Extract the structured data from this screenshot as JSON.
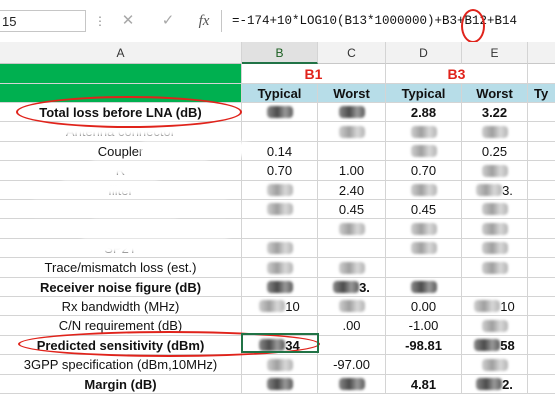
{
  "formula_bar": {
    "name_box": "15",
    "cancel_glyph": "✕",
    "enter_glyph": "✓",
    "fx_glyph": "fx",
    "formula": "=-174+10*LOG10(B13*1000000)+B3+B12+B14"
  },
  "columns": [
    "A",
    "B",
    "C",
    "D",
    "E"
  ],
  "groups": {
    "g1": "B1",
    "g2": "B3"
  },
  "subheaders": {
    "typical": "Typical",
    "worst": "Worst",
    "typical2": "Typical",
    "worst2": "Worst",
    "cut": "Ty"
  },
  "rows": [
    {
      "label": "Total loss before LNA (dB)",
      "bold": true,
      "b": "",
      "c": "",
      "d": "2.88",
      "e": "3.22"
    },
    {
      "label": "Antenna connector",
      "bold": false,
      "b": "",
      "c": "",
      "d": "",
      "e": ""
    },
    {
      "label": "Coupler",
      "bold": false,
      "b": "0.14",
      "c": "",
      "d": "",
      "e": "0.25"
    },
    {
      "label": "R",
      "bold": false,
      "b": "0.70",
      "c": "1.00",
      "d": "0.70",
      "e": ""
    },
    {
      "label": "filter",
      "bold": false,
      "b": "",
      "c": "2.40",
      "d": "",
      "e": "3."
    },
    {
      "label": "",
      "bold": false,
      "b": "",
      "c": "0.45",
      "d": "0.45",
      "e": ""
    },
    {
      "label": "",
      "bold": false,
      "b": "",
      "c": "",
      "d": "",
      "e": ""
    },
    {
      "label": "SP2T",
      "bold": false,
      "b": "",
      "c": "",
      "d": "",
      "e": ""
    },
    {
      "label": "Trace/mismatch loss (est.)",
      "bold": false,
      "b": "",
      "c": "",
      "d": "",
      "e": ""
    },
    {
      "label": "Receiver noise figure (dB)",
      "bold": true,
      "b": "",
      "c": "3.",
      "d": "",
      "e": ""
    },
    {
      "label": "Rx bandwidth (MHz)",
      "bold": false,
      "b": "10",
      "c": "",
      "d": "0.00",
      "e": "10"
    },
    {
      "label": "C/N requirement (dB)",
      "bold": false,
      "b": "",
      "c": ".00",
      "d": "-1.00",
      "e": ""
    },
    {
      "label": "Predicted sensitivity (dBm)",
      "bold": true,
      "b": "34",
      "c": "",
      "d": "-98.81",
      "e": "58"
    },
    {
      "label": "3GPP specification (dBm,10MHz)",
      "bold": false,
      "b": "",
      "c": "-97.00",
      "d": "",
      "e": ""
    },
    {
      "label": "Margin (dB)",
      "bold": true,
      "b": "",
      "c": "",
      "d": "4.81",
      "e": "2."
    }
  ]
}
